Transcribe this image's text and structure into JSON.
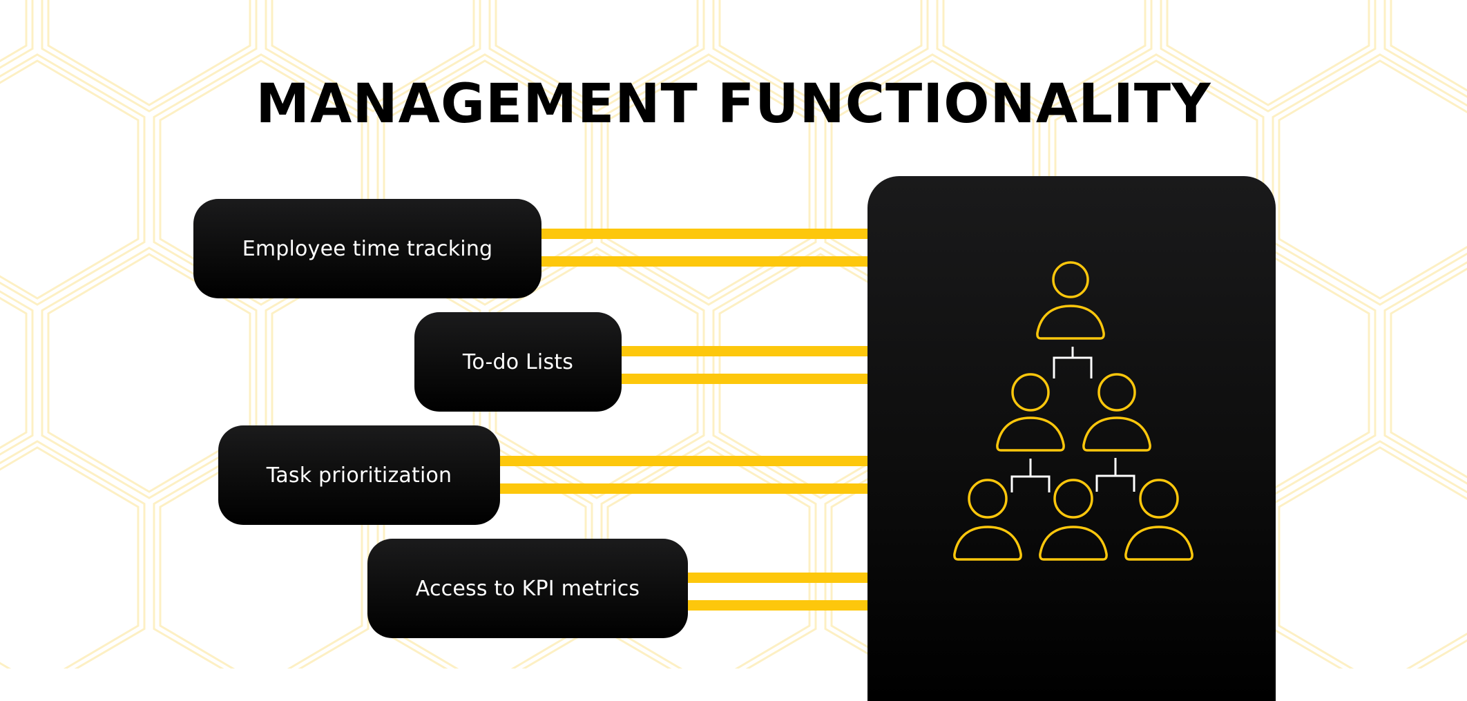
{
  "slide": {
    "title": "MANAGEMENT FUNCTIONALITY",
    "colors": {
      "accent": "#fdc70c",
      "pill_background": "#0c0c0c",
      "panel_background": "#111111",
      "text_on_dark": "#ffffff",
      "title_text": "#000000",
      "connector_white": "#ffffff",
      "background_pattern": "#fdf0c4"
    }
  },
  "features": [
    {
      "label": "Employee time tracking"
    },
    {
      "label": "To-do Lists"
    },
    {
      "label": "Task prioritization"
    },
    {
      "label": "Access to KPI metrics"
    }
  ],
  "org_chart": {
    "icon": "team-hierarchy-icon",
    "levels": [
      {
        "people": 1
      },
      {
        "people": 2
      },
      {
        "people": 3
      }
    ],
    "person_icon": "person-outline-icon"
  }
}
